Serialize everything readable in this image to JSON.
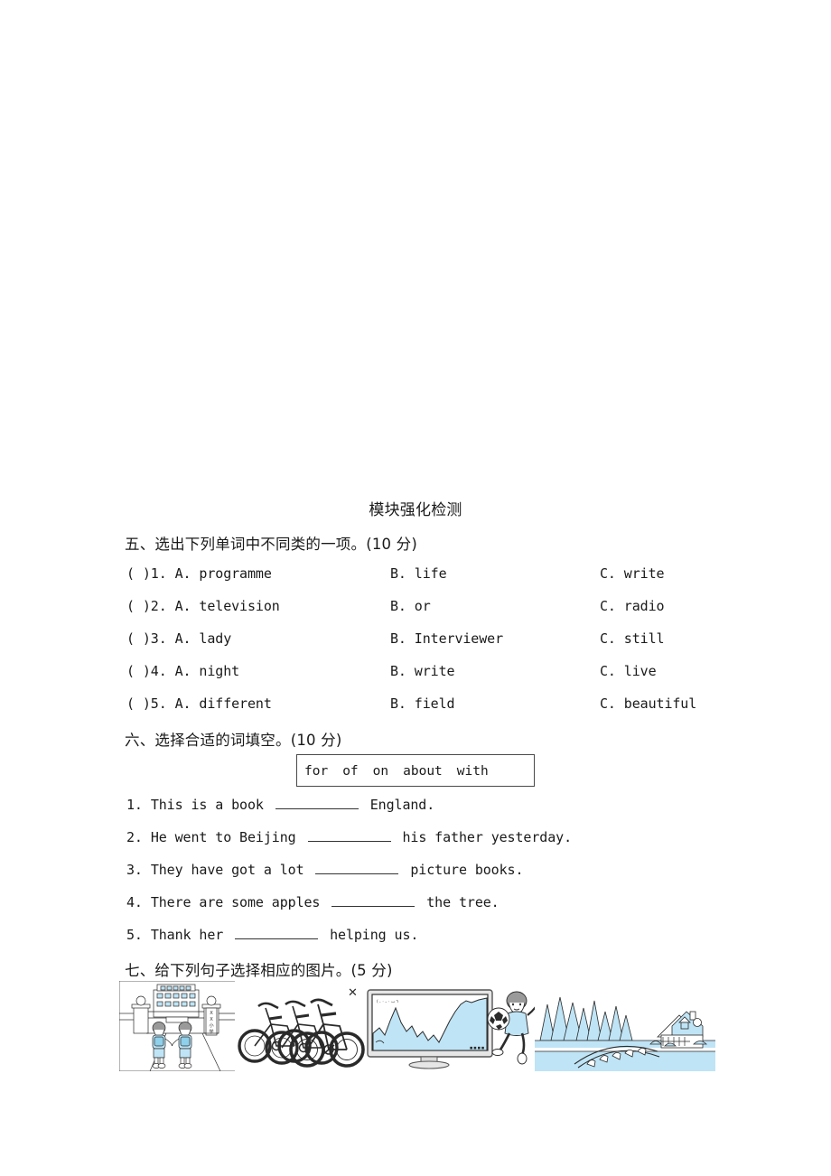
{
  "document": {
    "title": "模块强化检测",
    "page_background": "#ffffff",
    "text_color": "#1a1a1a"
  },
  "sections": [
    {
      "id": "part-five",
      "heading": "五、选出下列单词中不同类的一项。(10 分)",
      "type": "multiple-choice",
      "items": [
        {
          "bracket": "(    )",
          "number": "1.",
          "a": "A. programme",
          "b": "B. life",
          "c": "C. write"
        },
        {
          "bracket": "(    )",
          "number": "2.",
          "a": "A. television",
          "b": "B. or",
          "c": "C. radio"
        },
        {
          "bracket": "(    )",
          "number": "3.",
          "a": "A. lady",
          "b": "B. Interviewer",
          "c": "C. still"
        },
        {
          "bracket": "(    )",
          "number": "4.",
          "a": "A. night",
          "b": "B. write",
          "c": "C. live"
        },
        {
          "bracket": "(    )",
          "number": "5.",
          "a": "A. different",
          "b": "B. field",
          "c": "C. beautiful"
        }
      ]
    },
    {
      "id": "part-six",
      "heading": "六、选择合适的词填空。(10 分)",
      "type": "fill-in-the-blank",
      "word_bank": [
        "for",
        "of",
        "on",
        "about",
        "with"
      ],
      "items": [
        {
          "number": "1.",
          "before": "This is a book",
          "after": "England."
        },
        {
          "number": "2.",
          "before": "He went to Beijing",
          "after": "his father yesterday."
        },
        {
          "number": "3.",
          "before": "They have got a lot",
          "after": "picture books."
        },
        {
          "number": "4.",
          "before": "There are some apples",
          "after": "the tree."
        },
        {
          "number": "5.",
          "before": "Thank her",
          "after": "helping us."
        }
      ]
    },
    {
      "id": "part-seven",
      "heading": "七、给下列句子选择相应的图片。(5 分)",
      "type": "picture-matching",
      "pictures": [
        {
          "name": "school-gate-students",
          "caption": ""
        },
        {
          "name": "bicycles",
          "caption": ""
        },
        {
          "name": "television-football",
          "caption": ""
        },
        {
          "name": "countryside-scenery",
          "caption": ""
        }
      ],
      "cross_mark": "✕"
    }
  ],
  "palette": {
    "ink": "#1a1a1a",
    "line": "#333333",
    "illustration_fill": "#bfe4f5",
    "illustration_stroke": "#2b2b2b",
    "bike_dark": "#2a2a2a"
  }
}
